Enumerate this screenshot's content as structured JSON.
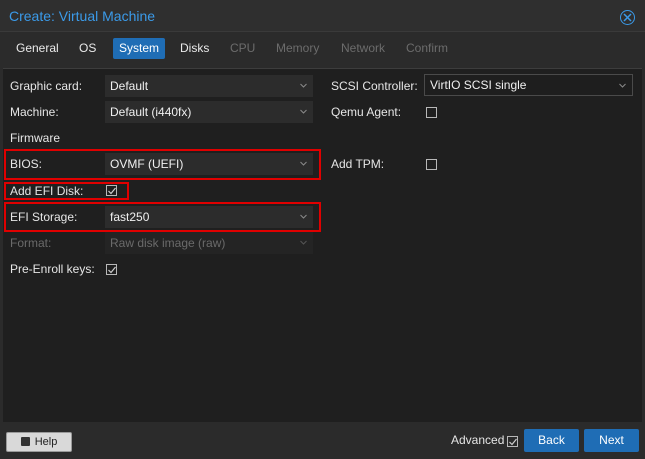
{
  "window": {
    "title": "Create: Virtual Machine"
  },
  "tabs": [
    {
      "label": "General",
      "state": "normal"
    },
    {
      "label": "OS",
      "state": "normal"
    },
    {
      "label": "System",
      "state": "active"
    },
    {
      "label": "Disks",
      "state": "normal"
    },
    {
      "label": "CPU",
      "state": "disabled"
    },
    {
      "label": "Memory",
      "state": "disabled"
    },
    {
      "label": "Network",
      "state": "disabled"
    },
    {
      "label": "Confirm",
      "state": "disabled"
    }
  ],
  "form": {
    "graphic_card": {
      "label": "Graphic card:",
      "value": "Default"
    },
    "machine": {
      "label": "Machine:",
      "value": "Default (i440fx)"
    },
    "firmware_heading": "Firmware",
    "bios": {
      "label": "BIOS:",
      "value": "OVMF (UEFI)"
    },
    "add_efi_disk": {
      "label": "Add EFI Disk:",
      "checked": true
    },
    "efi_storage": {
      "label": "EFI Storage:",
      "value": "fast250"
    },
    "format": {
      "label": "Format:",
      "value": "Raw disk image (raw)",
      "disabled": true
    },
    "pre_enroll": {
      "label": "Pre-Enroll keys:",
      "checked": true
    },
    "scsi_controller": {
      "label": "SCSI Controller:",
      "value": "VirtIO SCSI single"
    },
    "qemu_agent": {
      "label": "Qemu Agent:",
      "checked": false
    },
    "add_tpm": {
      "label": "Add TPM:",
      "checked": false
    }
  },
  "footer": {
    "help_label": "Help",
    "advanced_label": "Advanced",
    "advanced_checked": true,
    "back_label": "Back",
    "next_label": "Next"
  },
  "colors": {
    "accent": "#1f6db5",
    "title": "#3b9ae8",
    "highlight": "#e00000",
    "panel_bg": "#1f1f1f"
  }
}
